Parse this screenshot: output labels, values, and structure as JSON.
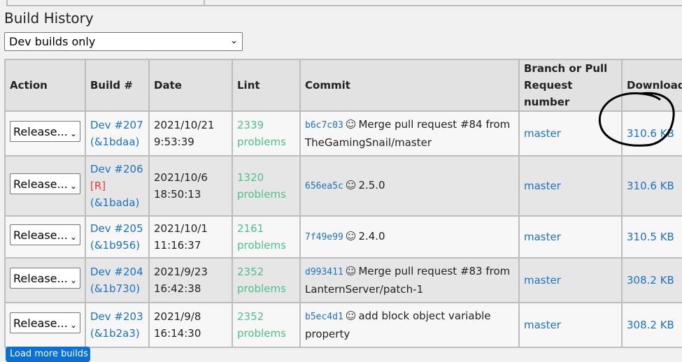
{
  "section_title": "Build History",
  "filter": {
    "selected": "Dev builds only"
  },
  "columns": [
    "Action",
    "Build #",
    "Date",
    "Lint",
    "Commit",
    "Branch or Pull Request number",
    "Download"
  ],
  "rows": [
    {
      "action": "Release...",
      "build": "Dev #207",
      "flag": "",
      "hash_short": "(&1bdaa)",
      "date": "2021/10/21",
      "time": "9:53:39",
      "lint_count": "2339",
      "lint_word": "problems",
      "commit_hash": "b6c7c03",
      "commit_msg": "Merge pull request #84 from TheGamingSnail/master",
      "branch": "master",
      "download": "310.6 KB"
    },
    {
      "action": "Release...",
      "build": "Dev #206",
      "flag": "[R]",
      "hash_short": "(&1bada)",
      "date": "2021/10/6",
      "time": "18:50:13",
      "lint_count": "1320",
      "lint_word": "problems",
      "commit_hash": "656ea5c",
      "commit_msg": "2.5.0",
      "branch": "master",
      "download": "310.6 KB"
    },
    {
      "action": "Release...",
      "build": "Dev #205",
      "flag": "",
      "hash_short": "(&1b956)",
      "date": "2021/10/1",
      "time": "11:16:37",
      "lint_count": "2161",
      "lint_word": "problems",
      "commit_hash": "7f49e99",
      "commit_msg": "2.4.0",
      "branch": "master",
      "download": "310.5 KB"
    },
    {
      "action": "Release...",
      "build": "Dev #204",
      "flag": "",
      "hash_short": "(&1b730)",
      "date": "2021/9/23",
      "time": "16:42:38",
      "lint_count": "2352",
      "lint_word": "problems",
      "commit_hash": "d993411",
      "commit_msg": "Merge pull request #83 from LanternServer/patch-1",
      "branch": "master",
      "download": "308.2 KB"
    },
    {
      "action": "Release...",
      "build": "Dev #203",
      "flag": "",
      "hash_short": "(&1b2a3)",
      "date": "2021/9/8",
      "time": "16:14:30",
      "lint_count": "2352",
      "lint_word": "problems",
      "commit_hash": "b5ec4d1",
      "commit_msg": "add block object variable property",
      "branch": "master",
      "download": "308.2 KB"
    }
  ],
  "load_more_label": "Load more builds",
  "colors": {
    "link": "#1a73c8",
    "lint": "#4dc18a",
    "flag": "#e23b2e",
    "button": "#0a6fd6"
  },
  "icons": {
    "commit_author": "smiley-face-icon",
    "dropdown": "chevron-down-icon"
  }
}
